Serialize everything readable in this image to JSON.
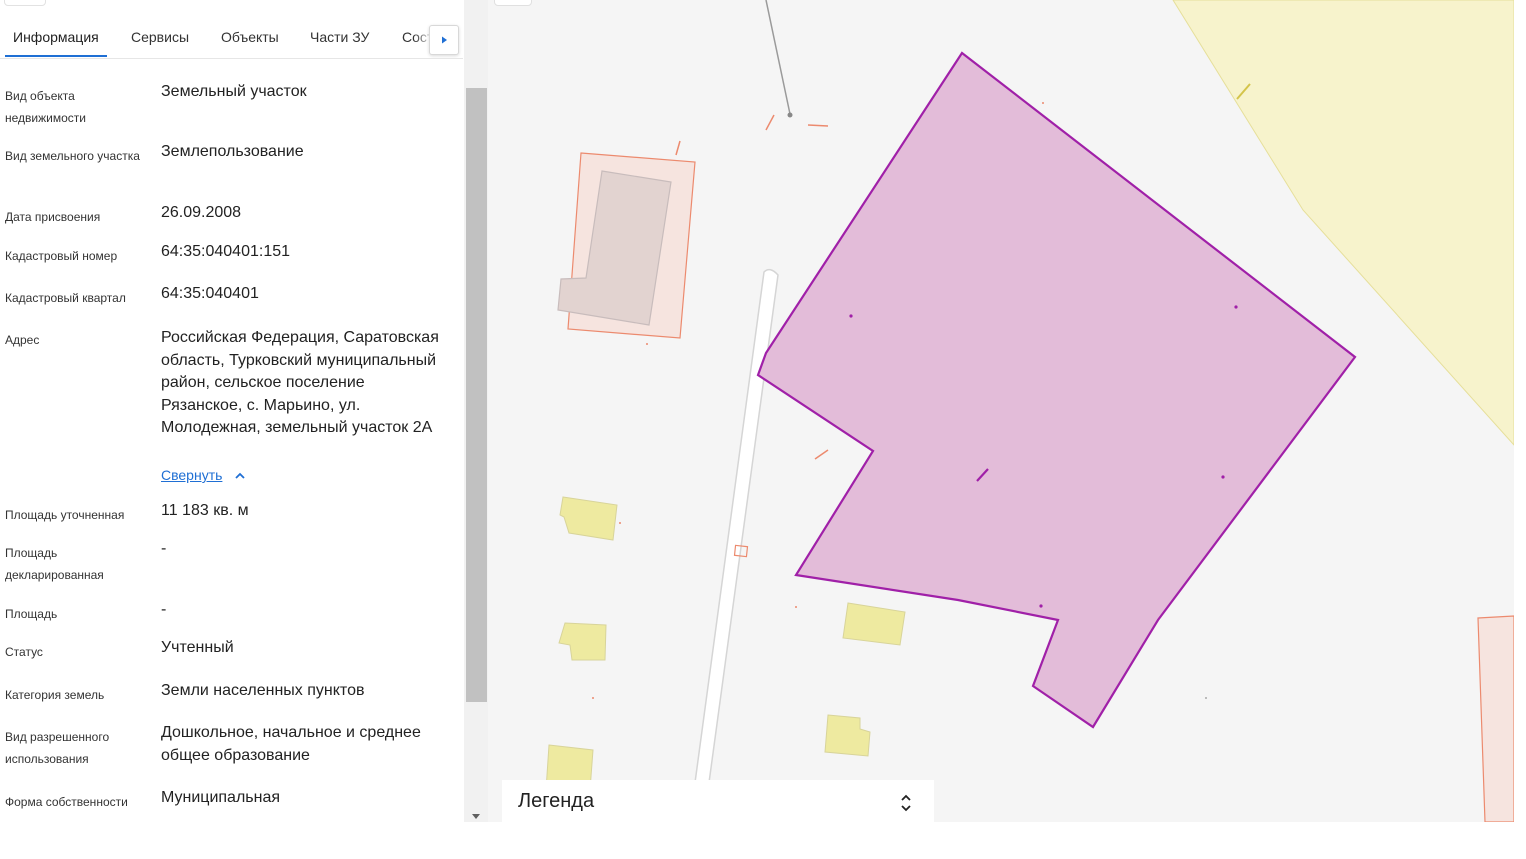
{
  "tabs": [
    "Информация",
    "Сервисы",
    "Объекты",
    "Части ЗУ",
    "Сост"
  ],
  "active_tab": "Информация",
  "fields": [
    {
      "label": "Вид объекта недвижимости",
      "value": "Земельный участок"
    },
    {
      "label": "Вид земельного участка",
      "value": "Землепользование"
    },
    {
      "label": "Дата присвоения",
      "value": "26.09.2008"
    },
    {
      "label": "Кадастровый номер",
      "value": "64:35:040401:151"
    },
    {
      "label": "Кадастровый квартал",
      "value": "64:35:040401"
    },
    {
      "label": "Адрес",
      "value": "Российская Федерация, Саратовская область, Турковский муниципальный район, сельское поселение Рязанское, с. Марьино, ул. Молодежная, земельный участок 2А"
    },
    {
      "label": "Площадь уточненная",
      "value": "11 183 кв. м"
    },
    {
      "label": "Площадь декларированная",
      "value": "-"
    },
    {
      "label": "Площадь",
      "value": "-"
    },
    {
      "label": "Статус",
      "value": "Учтенный"
    },
    {
      "label": "Категория земель",
      "value": "Земли населенных пунктов"
    },
    {
      "label": "Вид разрешенного использования",
      "value": "Дошкольное, начальное и среднее общее образование"
    },
    {
      "label": "Форма собственности",
      "value": "Муниципальная"
    }
  ],
  "address_toggle": "Свернуть",
  "legend": {
    "title": "Легенда"
  },
  "colors": {
    "accent": "#1f6fd4",
    "parcel_fill": "#e3bcd9",
    "parcel_stroke": "#a020a8",
    "building_fill": "#eeeaa0",
    "neighbor_parcel_stroke": "#ec8a6e",
    "zone_fill": "#f7f3cc",
    "map_background": "#f5f5f5"
  },
  "icons": [
    "chevron-right-icon",
    "chevron-up-icon",
    "expand-collapse-icon",
    "scroll-down-arrow-icon"
  ]
}
